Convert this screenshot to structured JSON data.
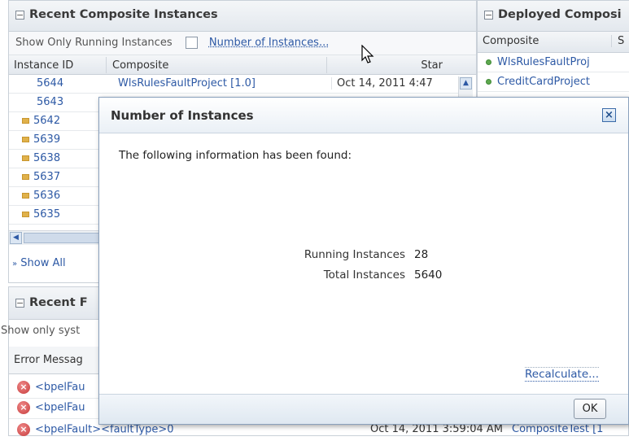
{
  "recent_panel": {
    "title": "Recent Composite Instances",
    "show_running_label": "Show Only Running Instances",
    "number_of_instances_link": "Number of Instances...",
    "columns": [
      "Instance ID",
      "Composite",
      "Star"
    ],
    "rows": [
      {
        "id": "5644",
        "composite": "WlsRulesFaultProject [1.0]",
        "start": "Oct 14, 2011 4:47",
        "marker": "none"
      },
      {
        "id": "5643",
        "composite": "",
        "start": "",
        "marker": "none"
      },
      {
        "id": "5642",
        "composite": "",
        "start": "",
        "marker": "square"
      },
      {
        "id": "5639",
        "composite": "",
        "start": "",
        "marker": "square"
      },
      {
        "id": "5638",
        "composite": "",
        "start": "",
        "marker": "square"
      },
      {
        "id": "5637",
        "composite": "",
        "start": "",
        "marker": "square"
      },
      {
        "id": "5636",
        "composite": "",
        "start": "",
        "marker": "square"
      },
      {
        "id": "5635",
        "composite": "",
        "start": "",
        "marker": "square"
      }
    ],
    "show_all_label": "Show All"
  },
  "deployed_panel": {
    "title": "Deployed Composi",
    "columns": [
      "Composite",
      "S"
    ],
    "items": [
      "WlsRulesFaultProj",
      "CreditCardProject"
    ]
  },
  "faults_panel": {
    "title": "Recent F",
    "show_only_label": "Show only syst",
    "error_header": "Error Messag",
    "rows": [
      "<bpelFau",
      "<bpelFau",
      "<bpelFault><faultType>0"
    ],
    "bottom_date": "Oct 14, 2011 3:59:04 AM",
    "bottom_composite": "CompositeTest [1"
  },
  "dialog": {
    "title": "Number of Instances",
    "message": "The following information has been found:",
    "running_label": "Running Instances",
    "running_value": "28",
    "total_label": "Total Instances",
    "total_value": "5640",
    "recalculate_label": "Recalculate...",
    "ok_label": "OK"
  },
  "colors": {
    "accent_link": "#2d59a5",
    "dialog_border": "#8aa1bd",
    "error_red": "#c63a3a",
    "status_green": "#5ea84f"
  }
}
